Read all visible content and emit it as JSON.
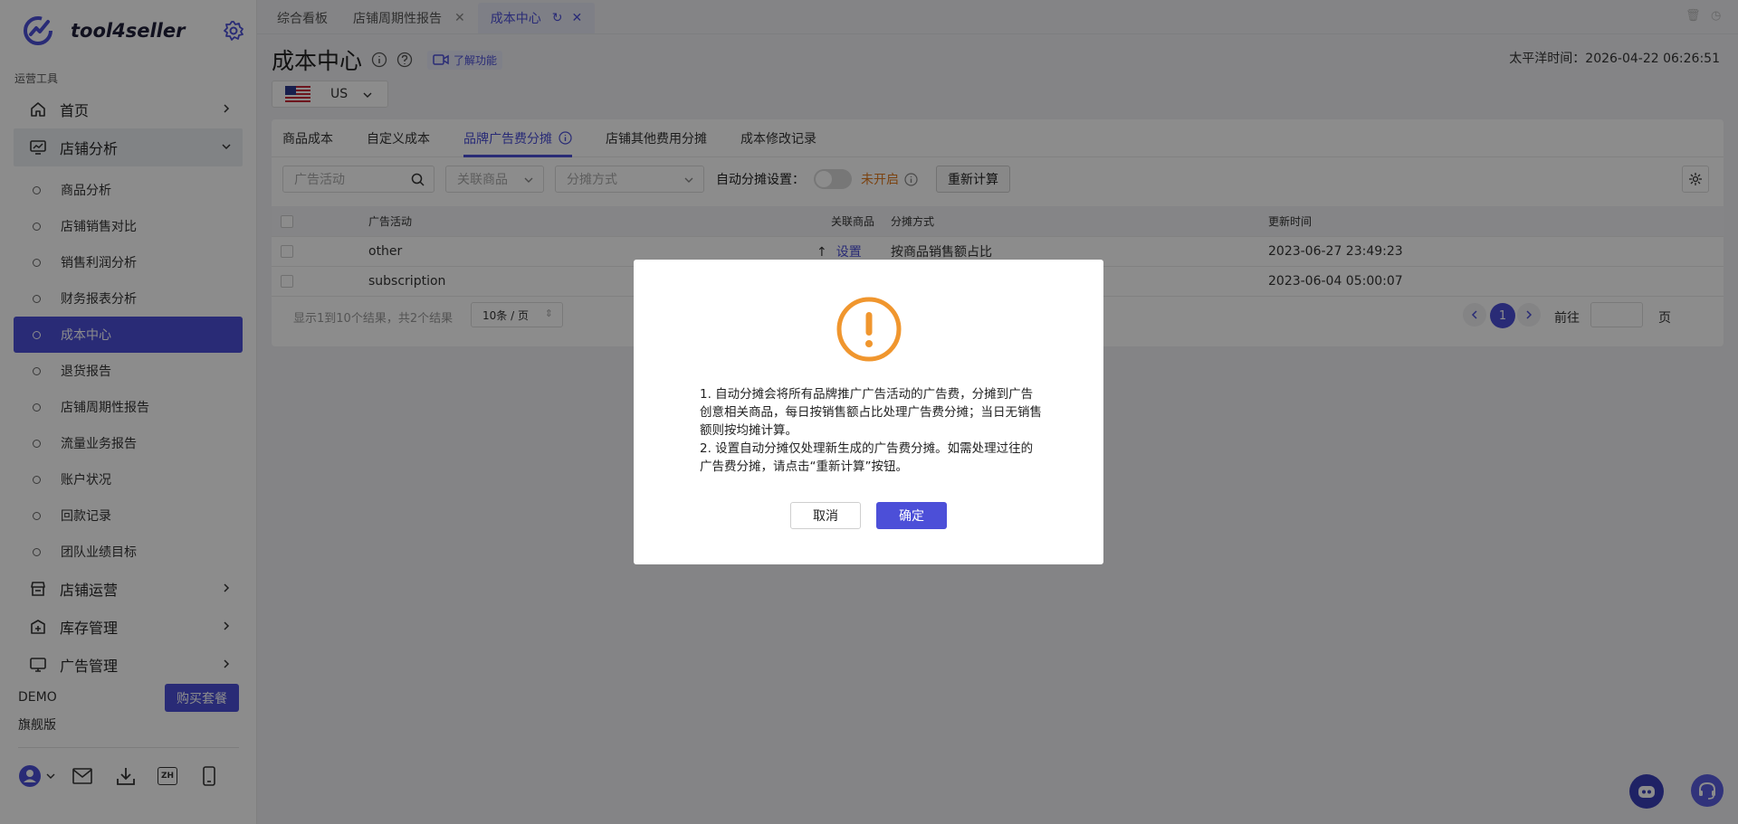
{
  "app": {
    "logo_text": "tool4seller"
  },
  "sidebar": {
    "section_label": "运营工具",
    "home": "首页",
    "store_analysis": "店铺分析",
    "sub_items": [
      "商品分析",
      "店铺销售对比",
      "销售利润分析",
      "财务报表分析",
      "成本中心",
      "退货报告",
      "店铺周期性报告",
      "流量业务报告",
      "账户状况",
      "回款记录",
      "团队业绩目标"
    ],
    "store_ops": "店铺运营",
    "inventory": "库存管理",
    "ads": "广告管理",
    "plan_name": "DEMO",
    "plan_tier": "旗舰版",
    "buy_button": "购买套餐",
    "lang_icon_text": "ZH"
  },
  "tabs": [
    {
      "label": "综合看板"
    },
    {
      "label": "店铺周期性报告"
    },
    {
      "label": "成本中心"
    }
  ],
  "page": {
    "title": "成本中心",
    "learn_label": "了解功能",
    "pacific_time": "太平洋时间：2026-04-22 06:26:51",
    "country_code": "US"
  },
  "subtabs": [
    "商品成本",
    "自定义成本",
    "品牌广告费分摊",
    "店铺其他费用分摊",
    "成本修改记录"
  ],
  "filters": {
    "campaign_placeholder": "广告活动",
    "product_placeholder": "关联商品",
    "mode_placeholder": "分摊方式",
    "auto_label": "自动分摊设置：",
    "auto_status": "未开启",
    "recalc_button": "重新计算"
  },
  "table": {
    "headers": {
      "campaign": "广告活动",
      "product": "关联商品",
      "mode": "分摊方式",
      "updated": "更新时间"
    },
    "rows": [
      {
        "campaign": "other",
        "product_link": "设置",
        "mode": "按商品销售额占比",
        "updated": "2023-06-27 23:49:23"
      },
      {
        "campaign": "subscription",
        "product_link": "",
        "mode": "",
        "updated": "2023-06-04 05:00:07"
      }
    ]
  },
  "pager": {
    "summary": "显示1到10个结果，共2个结果",
    "page_size": "10条 / 页",
    "current": "1",
    "goto_label": "前往",
    "unit": "页"
  },
  "dialog": {
    "line1": "1. 自动分摊会将所有品牌推广广告活动的广告费，分摊到广告创意相关商品，每日按销售额占比处理广告费分摊；当日无销售额则按均摊计算。",
    "line2": "2. 设置自动分摊仅处理新生成的广告费分摊。如需处理过往的广告费分摊，请点击“重新计算”按钮。",
    "cancel": "取消",
    "ok": "确定"
  },
  "colors": {
    "accent": "#4c4fd8",
    "warning": "#f0962e",
    "off_status": "#e07a1f"
  }
}
